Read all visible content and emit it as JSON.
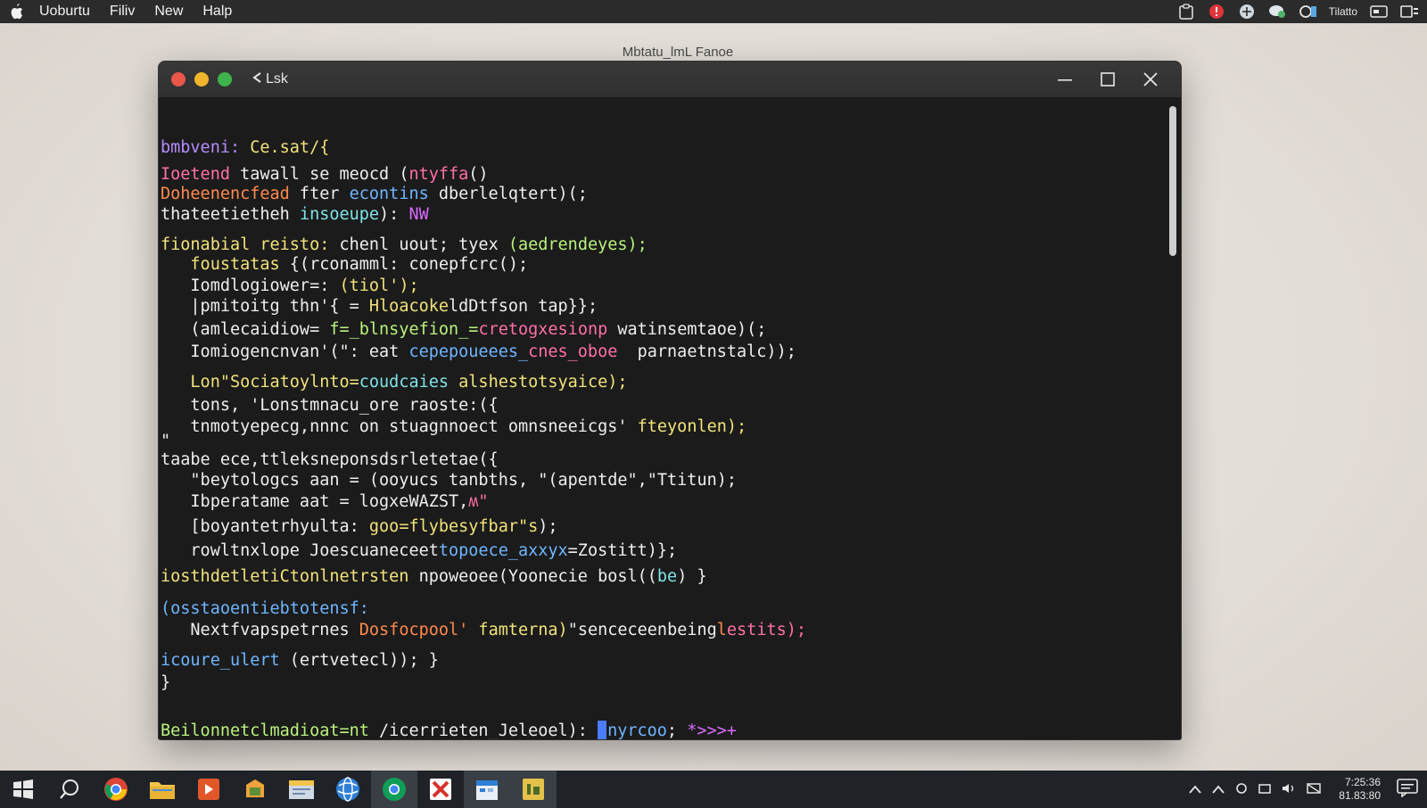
{
  "menubar": {
    "items": [
      "Uoburtu",
      "Filiv",
      "New",
      "Halp"
    ],
    "tray_user": "Tilatto"
  },
  "window": {
    "outer_title": "Mbtatu_lmL Fanoe",
    "tab_title": "Lsk"
  },
  "terminal": {
    "lines": [
      [
        {
          "t": "bmbveni:",
          "c": "c-purple"
        },
        {
          "t": " Ce.sat/{",
          "c": "c-yellow"
        }
      ],
      [
        {
          "t": "Ioetend",
          "c": "c-pink"
        },
        {
          "t": " tawall se meocd (",
          "c": "c-white"
        },
        {
          "t": "ntyffa",
          "c": "c-pink"
        },
        {
          "t": "()",
          "c": "c-white"
        }
      ],
      [
        {
          "t": "Doheenencfead",
          "c": "c-orange"
        },
        {
          "t": " fter ",
          "c": "c-white"
        },
        {
          "t": "econtins",
          "c": "c-blue"
        },
        {
          "t": " dberlelqtert)(;",
          "c": "c-white"
        }
      ],
      [
        {
          "t": "thateetietheh ",
          "c": "c-white"
        },
        {
          "t": "insoeupe",
          "c": "c-cyan"
        },
        {
          "t": "): ",
          "c": "c-white"
        },
        {
          "t": "NW",
          "c": "c-magenta"
        }
      ],
      [
        {
          "t": "fionabial reisto:",
          "c": "c-yellow"
        },
        {
          "t": " chenl uout; ",
          "c": "c-white"
        },
        {
          "t": "tyex",
          "c": "c-white"
        },
        {
          "t": " (aedrendeyes);",
          "c": "c-green"
        }
      ],
      [
        {
          "t": "   foustatas",
          "c": "c-yellow"
        },
        {
          "t": " {(rconamml: conepfcrc();",
          "c": "c-white"
        }
      ],
      [
        {
          "t": "   Iomdlogiower=:",
          "c": "c-white"
        },
        {
          "t": " (tiol');",
          "c": "c-yellow"
        }
      ],
      [
        {
          "t": "   |pmitoitg thn'{ = ",
          "c": "c-white"
        },
        {
          "t": "Hloacoke",
          "c": "c-yellow"
        },
        {
          "t": "ldDtfson tap}};",
          "c": "c-white"
        }
      ],
      [
        {
          "t": "   (amlecaidiow=",
          "c": "c-white"
        },
        {
          "t": " f=_blnsyefion_=",
          "c": "c-green"
        },
        {
          "t": "cretogxesionp",
          "c": "c-pink"
        },
        {
          "t": " watinsemtaoe)(;",
          "c": "c-white"
        }
      ],
      [
        {
          "t": "   Iomiogencnvan'(\": eat ",
          "c": "c-white"
        },
        {
          "t": "cepepoueees_",
          "c": "c-blue"
        },
        {
          "t": "cnes_oboe",
          "c": "c-pink"
        },
        {
          "t": "  parnaetnstalc));",
          "c": "c-white"
        }
      ],
      [
        {
          "t": "   Lon\"Sociatoylnto=",
          "c": "c-yellow"
        },
        {
          "t": "coudcaies",
          "c": "c-cyan"
        },
        {
          "t": " alshestotsyaice);",
          "c": "c-yellow"
        }
      ],
      [
        {
          "t": "   tons, 'Lonstmnacu_ore raoste:({",
          "c": "c-white"
        }
      ],
      [
        {
          "t": "   tnmotyepecg,nnnc on stuagnnoect omnsneeicgs' ",
          "c": "c-white"
        },
        {
          "t": "fteyonlen);",
          "c": "c-yellow"
        }
      ],
      [
        {
          "t": "\"",
          "c": "c-white"
        }
      ],
      [
        {
          "t": "taabe ece,ttleksneponsdsrletetae({",
          "c": "c-white"
        }
      ],
      [
        {
          "t": "   \"beytologcs aan = (ooyucs tanbths, \"(apentde\",\"Ttitun);",
          "c": "c-white"
        }
      ],
      [
        {
          "t": "   Ibperatame aat = logxeWAZST,",
          "c": "c-white"
        },
        {
          "t": "ʍ\"",
          "c": "c-pink"
        }
      ],
      [
        {
          "t": "   [boyantetrhyulta: ",
          "c": "c-white"
        },
        {
          "t": "goo=flybesyfbar\"s",
          "c": "c-yellow"
        },
        {
          "t": ");",
          "c": "c-white"
        }
      ],
      [
        {
          "t": "   rowltnxlope Joescuaneceet",
          "c": "c-white"
        },
        {
          "t": "topoece_axxyx",
          "c": "c-blue"
        },
        {
          "t": "=Zostitt)};",
          "c": "c-white"
        }
      ],
      [
        {
          "t": "iosthdetletiCtonlnetrsten ",
          "c": "c-yellow"
        },
        {
          "t": "npoweoee(Yoonecie bosl((",
          "c": "c-white"
        },
        {
          "t": "be",
          "c": "c-cyan"
        },
        {
          "t": ") }",
          "c": "c-white"
        }
      ],
      [
        {
          "t": "(osstaoentiebtotensf:",
          "c": "c-blue"
        }
      ],
      [
        {
          "t": "   Nextfvapspetrnes ",
          "c": "c-white"
        },
        {
          "t": "Dosfocpool'",
          "c": "c-orange"
        },
        {
          "t": " famterna)",
          "c": "c-yellow"
        },
        {
          "t": "\"senceceenbeing",
          "c": "c-white"
        },
        {
          "t": "l",
          "c": "c-orange"
        },
        {
          "t": "estits);",
          "c": "c-pink"
        }
      ],
      [
        {
          "t": "icoure_ulert",
          "c": "c-blue"
        },
        {
          "t": " (ertvetecl)); }",
          "c": "c-white"
        }
      ],
      [
        {
          "t": "}",
          "c": "c-white"
        }
      ]
    ],
    "prompt": [
      {
        "t": "Beilonnetclmadioat=nt ",
        "c": "c-green"
      },
      {
        "t": "/icerrieten_Jeleoel): ",
        "c": "c-white"
      },
      {
        "t": "nyrcoo",
        "c": "c-blue"
      },
      {
        "t": "; ",
        "c": "c-white"
      },
      {
        "t": "*>>>+",
        "c": "c-magenta"
      }
    ]
  },
  "taskbar": {
    "clock_time": "7:25:36",
    "clock_date": "81.83:80"
  },
  "colors": {
    "menubar_bg": "#2b2b2b",
    "terminal_bg": "#1b1b1b",
    "taskbar_bg": "#1f2327",
    "cursor": "#4b7bff"
  },
  "icons": [
    "apple-icon",
    "terminal-prompt-icon",
    "minimize-icon",
    "maximize-icon",
    "close-icon",
    "windows-start-icon",
    "search-icon",
    "chrome-icon",
    "folder-icon",
    "app-icon"
  ]
}
